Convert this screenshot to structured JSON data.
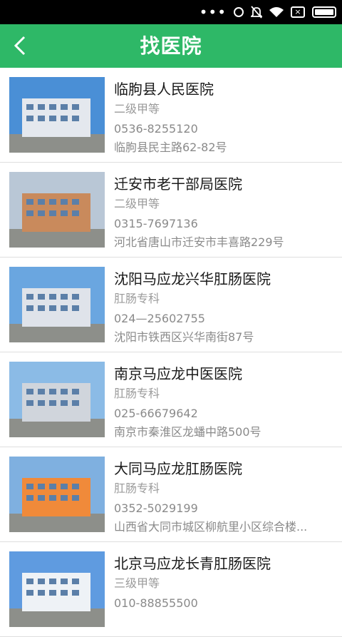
{
  "header": {
    "title": "找医院",
    "back_icon": "chevron-left-icon"
  },
  "colors": {
    "appbar": "#2eb867",
    "statusbar": "#000000"
  },
  "status_icons": [
    "more-dots-icon",
    "rotate-lock-icon",
    "mute-bell-icon",
    "wifi-icon",
    "sim-x-icon",
    "battery-icon"
  ],
  "hospitals": [
    {
      "name": "临朐县人民医院",
      "level": "二级甲等",
      "phone": "0536-8255120",
      "address": "临朐县民主路62-82号"
    },
    {
      "name": "迁安市老干部局医院",
      "level": "二级甲等",
      "phone": "0315-7697136",
      "address": "河北省唐山市迁安市丰喜路229号"
    },
    {
      "name": "沈阳马应龙兴华肛肠医院",
      "level": "肛肠专科",
      "phone": "024—25602755",
      "address": "沈阳市铁西区兴华南街87号"
    },
    {
      "name": "南京马应龙中医医院",
      "level": "肛肠专科",
      "phone": "025-66679642",
      "address": "南京市秦淮区龙蟠中路500号"
    },
    {
      "name": "大同马应龙肛肠医院",
      "level": "肛肠专科",
      "phone": "0352-5029199",
      "address": "山西省大同市城区柳航里小区综合楼..."
    },
    {
      "name": "北京马应龙长青肛肠医院",
      "level": "三级甲等",
      "phone": "010-88855500",
      "address": ""
    }
  ]
}
